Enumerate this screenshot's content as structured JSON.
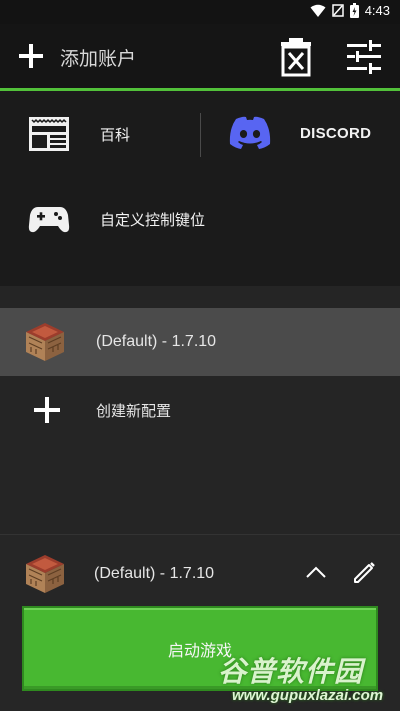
{
  "status_bar": {
    "time": "4:43"
  },
  "top_bar": {
    "title": "添加账户"
  },
  "links": {
    "wiki_label": "百科",
    "discord_label": "DISCORD",
    "controls_label": "自定义控制键位"
  },
  "profiles": {
    "items": [
      {
        "label": "(Default) - 1.7.10"
      }
    ],
    "create_label": "创建新配置"
  },
  "bottom": {
    "selected_profile": "(Default) - 1.7.10",
    "launch_label": "启动游戏"
  },
  "watermark": {
    "brand": "谷普软件园",
    "url": "www.gupuxlazai.com"
  },
  "colors": {
    "accent_green": "#52c13a",
    "launch_button": "#48b831",
    "discord_blue": "#5865f2",
    "selected_row": "#4b4b4b"
  }
}
